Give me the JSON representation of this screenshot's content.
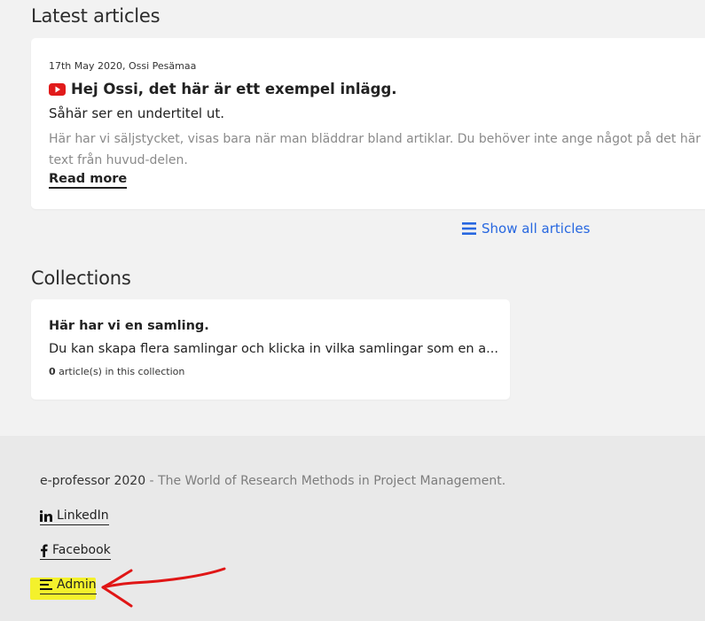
{
  "latest": {
    "heading": "Latest articles",
    "article": {
      "meta": "17th May 2020, Ossi Pesämaa",
      "title": "Hej Ossi, det här är ett exempel inlägg.",
      "subtitle": "Såhär ser en undertitel ut.",
      "excerpt_line1": "Här har vi säljstycket, visas bara när man bläddrar bland artiklar. Du behöver inte ange något på det här",
      "excerpt_line2": "text från huvud-delen.",
      "read_more": "Read more",
      "icon": "youtube-icon"
    },
    "show_all": "Show all articles"
  },
  "collections": {
    "heading": "Collections",
    "item": {
      "title": "Här har vi en samling.",
      "description": "Du kan skapa flera samlingar och klicka in vilka samlingar som en a...",
      "count": "0",
      "count_suffix": " article(s) in this collection"
    }
  },
  "footer": {
    "brand": "e-professor 2020",
    "separator": " - ",
    "tagline": "The World of Research Methods in Project Management.",
    "links": {
      "linkedin": "LinkedIn",
      "facebook": "Facebook",
      "admin": "Admin"
    }
  },
  "colors": {
    "accent_link": "#2767e0",
    "youtube_red": "#e11b1b",
    "highlight": "#f6f20a",
    "annotation": "#e01616"
  }
}
